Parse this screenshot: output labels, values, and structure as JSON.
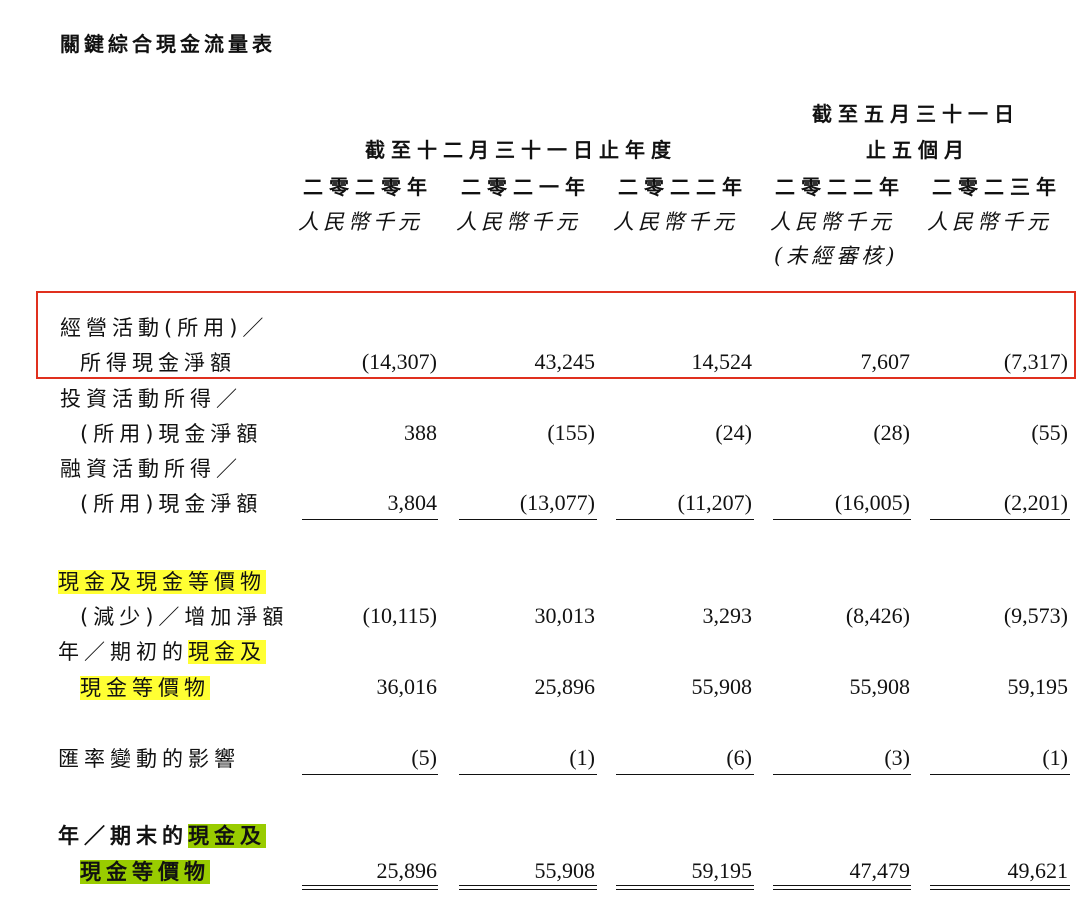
{
  "title": "關鍵綜合現金流量表",
  "header": {
    "year_group": "截至十二月三十一日止年度",
    "five_month_group_line1": "截至五月三十一日",
    "five_month_group_line2": "止五個月",
    "years": [
      "二零二零年",
      "二零二一年",
      "二零二二年",
      "二零二二年",
      "二零二三年"
    ],
    "unit": "人民幣千元",
    "unaudited": "(未經審核)"
  },
  "rows": [
    {
      "label1": "經營活動(所用)／",
      "label2": "所得現金淨額",
      "values": [
        "(14,307)",
        "43,245",
        "14,524",
        "7,607",
        "(7,317)"
      ]
    },
    {
      "label1": "投資活動所得／",
      "label2": "(所用)現金淨額",
      "values": [
        "388",
        "(155)",
        "(24)",
        "(28)",
        "(55)"
      ]
    },
    {
      "label1": "融資活動所得／",
      "label2": "(所用)現金淨額",
      "values": [
        "3,804",
        "(13,077)",
        "(11,207)",
        "(16,005)",
        "(2,201)"
      ]
    },
    {
      "label1": "現金及現金等價物",
      "label2": "(減少)／增加淨額",
      "values": [
        "(10,115)",
        "30,013",
        "3,293",
        "(8,426)",
        "(9,573)"
      ]
    },
    {
      "label1_a": "年／期初的",
      "label1_b": "現金及",
      "label2": "現金等價物",
      "values": [
        "36,016",
        "25,896",
        "55,908",
        "55,908",
        "59,195"
      ]
    },
    {
      "label1": "匯率變動的影響",
      "values": [
        "(5)",
        "(1)",
        "(6)",
        "(3)",
        "(1)"
      ]
    },
    {
      "label1_a": "年／期末的",
      "label1_b": "現金及",
      "label2": "現金等價物",
      "values": [
        "25,896",
        "55,908",
        "59,195",
        "47,479",
        "49,621"
      ]
    }
  ]
}
